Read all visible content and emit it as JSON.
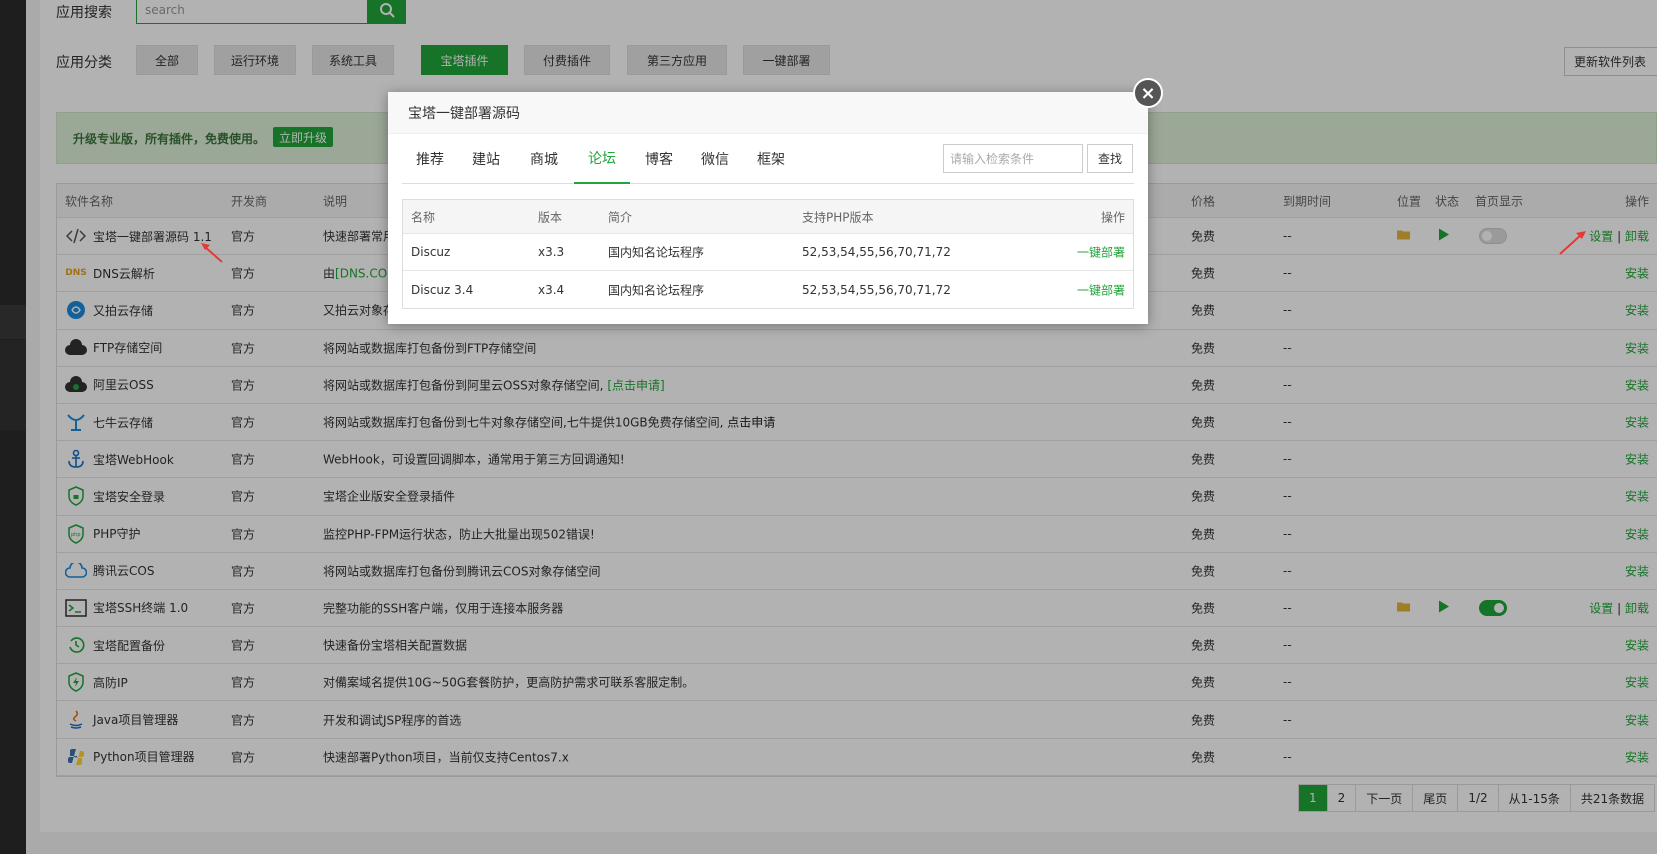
{
  "search": {
    "label": "应用搜索",
    "placeholder": "search"
  },
  "categories": {
    "label": "应用分类",
    "items": [
      "全部",
      "运行环境",
      "系统工具",
      "宝塔插件",
      "付费插件",
      "第三方应用",
      "一键部署"
    ],
    "active": "宝塔插件"
  },
  "refresh_button": "更新软件列表",
  "promo": {
    "text": "升级专业版，所有插件，免费使用。",
    "button": "立即升级"
  },
  "table": {
    "headers": {
      "name": "软件名称",
      "dev": "开发商",
      "desc": "说明",
      "price": "价格",
      "expire": "到期时间",
      "pos": "位置",
      "state": "状态",
      "home": "首页显示",
      "op": "操作"
    },
    "rows": [
      {
        "icon": "code-icon",
        "name": "宝塔一键部署源码 1.1",
        "dev": "官方",
        "desc": "快速部署常用",
        "price": "免费",
        "expire": "--",
        "op_settings": "设置",
        "op_sep": " | ",
        "op_uninstall": "卸载"
      },
      {
        "icon": "dns-icon",
        "name": "DNS云解析",
        "dev": "官方",
        "desc_prefix": "由",
        "desc_link": "[DNS.CO",
        "price": "免费",
        "expire": "--",
        "op": "安装"
      },
      {
        "icon": "upyun-icon",
        "name": "又拍云存储",
        "dev": "官方",
        "desc": "又拍云对象存",
        "price": "免费",
        "expire": "--",
        "op": "安装"
      },
      {
        "icon": "ftp-cloud-icon",
        "name": "FTP存储空间",
        "dev": "官方",
        "desc": "将网站或数据库打包备份到FTP存储空间",
        "price": "免费",
        "expire": "--",
        "op": "安装"
      },
      {
        "icon": "aliyun-oss-icon",
        "name": "阿里云OSS",
        "dev": "官方",
        "desc": "将网站或数据库打包备份到阿里云OSS对象存储空间,",
        "desc_link": "[点击申请]",
        "price": "免费",
        "expire": "--",
        "op": "安装"
      },
      {
        "icon": "qiniu-icon",
        "name": "七牛云存储",
        "dev": "官方",
        "desc": "将网站或数据库打包备份到七牛对象存储空间,七牛提供10GB免费存储空间,",
        "desc_bold": "点击申请",
        "price": "免费",
        "expire": "--",
        "op": "安装"
      },
      {
        "icon": "anchor-icon",
        "name": "宝塔WebHook",
        "dev": "官方",
        "desc": "WebHook，可设置回调脚本，通常用于第三方回调通知!",
        "price": "免费",
        "expire": "--",
        "op": "安装"
      },
      {
        "icon": "shield-lock-icon",
        "name": "宝塔安全登录",
        "dev": "官方",
        "desc": "宝塔企业版安全登录插件",
        "price": "免费",
        "expire": "--",
        "op": "安装"
      },
      {
        "icon": "php-shield-icon",
        "name": "PHP守护",
        "dev": "官方",
        "desc": "监控PHP-FPM运行状态，防止大批量出现502错误!",
        "price": "免费",
        "expire": "--",
        "op": "安装"
      },
      {
        "icon": "tencent-cos-icon",
        "name": "腾讯云COS",
        "dev": "官方",
        "desc": "将网站或数据库打包备份到腾讯云COS对象存储空间",
        "price": "免费",
        "expire": "--",
        "op": "安装"
      },
      {
        "icon": "terminal-icon",
        "name": "宝塔SSH终端 1.0",
        "dev": "官方",
        "desc": "完整功能的SSH客户端，仅用于连接本服务器",
        "price": "免费",
        "expire": "--",
        "op_settings": "设置",
        "op_sep": " | ",
        "op_uninstall": "卸载"
      },
      {
        "icon": "backup-icon",
        "name": "宝塔配置备份",
        "dev": "官方",
        "desc": "快速备份宝塔相关配置数据",
        "price": "免费",
        "expire": "--",
        "op": "安装"
      },
      {
        "icon": "lightning-shield-icon",
        "name": "高防IP",
        "dev": "官方",
        "desc": "对備案域名提供10G~50G套餐防护，更高防护需求可联系客服定制。",
        "price": "免费",
        "expire": "--",
        "op": "安装"
      },
      {
        "icon": "java-icon",
        "name": "Java项目管理器",
        "dev": "官方",
        "desc": "开发和调试JSP程序的首选",
        "price": "免费",
        "expire": "--",
        "op": "安装"
      },
      {
        "icon": "python-icon",
        "name": "Python项目管理器",
        "dev": "官方",
        "desc": "快速部署Python项目，当前仅支持Centos7.x",
        "price": "免费",
        "expire": "--",
        "op": "安装"
      }
    ]
  },
  "pager": {
    "p1": "1",
    "p2": "2",
    "next": "下一页",
    "last": "尾页",
    "ratio": "1/2",
    "range": "从1-15条",
    "total": "共21条数据"
  },
  "modal": {
    "title": "宝塔一键部署源码",
    "close": "×",
    "tabs": [
      "推荐",
      "建站",
      "商城",
      "论坛",
      "博客",
      "微信",
      "框架"
    ],
    "active_tab": "论坛",
    "search_placeholder": "请输入检索条件",
    "search_button": "查找",
    "headers": {
      "name": "名称",
      "version": "版本",
      "intro": "简介",
      "php": "支持PHP版本",
      "op": "操作"
    },
    "rows": [
      {
        "name": "Discuz",
        "version": "x3.3",
        "intro": "国内知名论坛程序",
        "php": "52,53,54,55,56,70,71,72",
        "op": "一键部署"
      },
      {
        "name": "Discuz 3.4",
        "version": "x3.4",
        "intro": "国内知名论坛程序",
        "php": "52,53,54,55,56,70,71,72",
        "op": "一键部署"
      }
    ]
  },
  "colors": {
    "accent": "#20a53a",
    "arrow": "#e53935"
  }
}
